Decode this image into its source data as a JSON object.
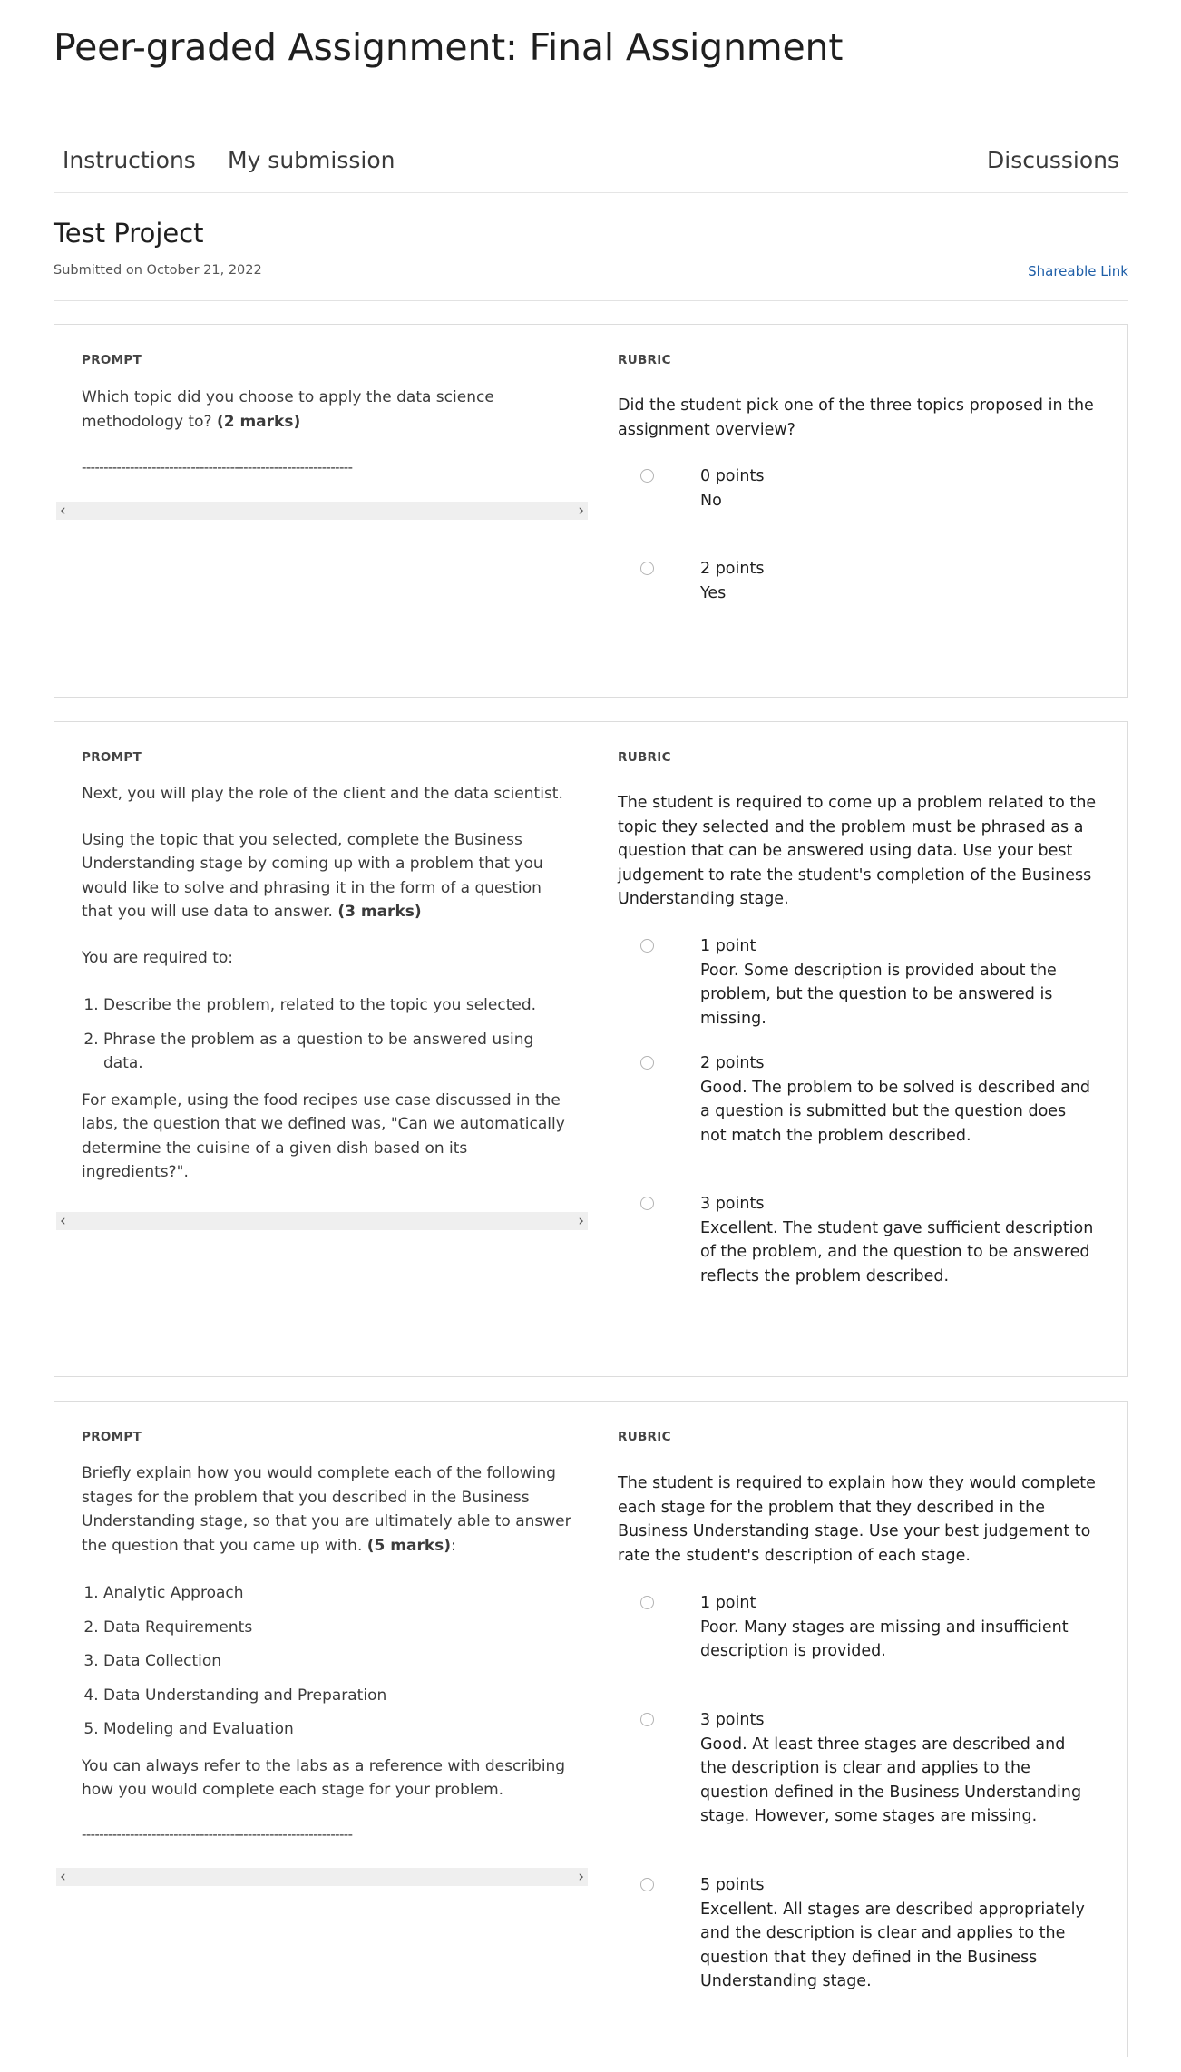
{
  "page": {
    "title": "Peer-graded Assignment: Final Assignment"
  },
  "tabs": [
    "Instructions",
    "My submission",
    "Discussions"
  ],
  "submission": {
    "title": "Test Project",
    "submitted_on": "Submitted on October 21, 2022",
    "shareable_link": "Shareable Link"
  },
  "labels": {
    "prompt": "PROMPT",
    "rubric": "RUBRIC"
  },
  "scroll_arrows": {
    "left": "‹",
    "right": "›"
  },
  "questions": [
    {
      "prompt": {
        "paragraphs": [
          {
            "text": "Which topic did you choose to apply the data science methodology to? ",
            "bold": "(2 marks)",
            "after": ""
          }
        ],
        "list": [],
        "closing": [],
        "dashes": "--------------------------------------------------------------"
      },
      "rubric": {
        "question": "Did the student pick one of the three topics proposed in the assignment overview?",
        "options": [
          {
            "points": "0 points",
            "description": "No"
          },
          {
            "points": "2 points",
            "description": "Yes"
          }
        ]
      }
    },
    {
      "prompt": {
        "paragraphs": [
          {
            "text": "Next, you will play the role of the client and the data scientist.",
            "bold": "",
            "after": ""
          },
          {
            "text": "Using the topic that you selected, complete the Business Understanding stage by coming up with a problem that you would like to solve and phrasing it in the form of a question that you will use data to answer. ",
            "bold": "(3 marks)",
            "after": ""
          },
          {
            "text": "You are required to:",
            "bold": "",
            "after": ""
          }
        ],
        "list": [
          "Describe the problem, related to the topic you selected.",
          "Phrase the problem as a question to be answered using data."
        ],
        "closing": [
          "For example, using the food recipes use case discussed in the labs, the question that we defined was, \"Can we automatically determine the cuisine of a given dish based on its ingredients?\"."
        ],
        "dashes": "--------------------------------------------------------------"
      },
      "rubric": {
        "question": "The student is required to come up a problem related to the topic they selected and the problem must be phrased as a question that can be answered using data. Use your best judgement to rate the student's completion of the Business Understanding stage.",
        "options": [
          {
            "points": "1 point",
            "description": "Poor. Some description is provided about the problem, but the question to be answered is missing."
          },
          {
            "points": "2 points",
            "description": "Good. The problem to be solved is described and a question is submitted but the question does not match the problem described."
          },
          {
            "points": "3 points",
            "description": "Excellent. The student gave sufficient description of the problem, and the question to be answered reflects the problem described."
          }
        ]
      }
    },
    {
      "prompt": {
        "paragraphs": [
          {
            "text": "Briefly explain how you would complete each of the following stages for the problem that you described in the Business Understanding stage, so that you are ultimately able to answer the question that you came up with. ",
            "bold": "(5 marks)",
            "after": ":"
          }
        ],
        "list": [
          "Analytic Approach",
          "Data Requirements",
          "Data Collection",
          "Data Understanding and Preparation",
          "Modeling and Evaluation"
        ],
        "closing": [
          "You can always refer to the labs as a reference with describing how you would complete each stage for your problem."
        ],
        "dashes": "--------------------------------------------------------------"
      },
      "rubric": {
        "question": "The student is required to explain how they would complete each stage for the problem that they described in the Business Understanding stage. Use your best judgement to rate the student's description of each stage.",
        "options": [
          {
            "points": "1 point",
            "description": "Poor. Many stages are missing and insufficient description is provided."
          },
          {
            "points": "3 points",
            "description": "Good. At least three stages are described and the description is clear and applies to the question defined in the Business Understanding stage. However, some stages are missing."
          },
          {
            "points": "5 points",
            "description": "Excellent. All stages are described appropriately and the description is clear and applies to the question that they defined in the Business Understanding stage."
          }
        ]
      }
    }
  ]
}
